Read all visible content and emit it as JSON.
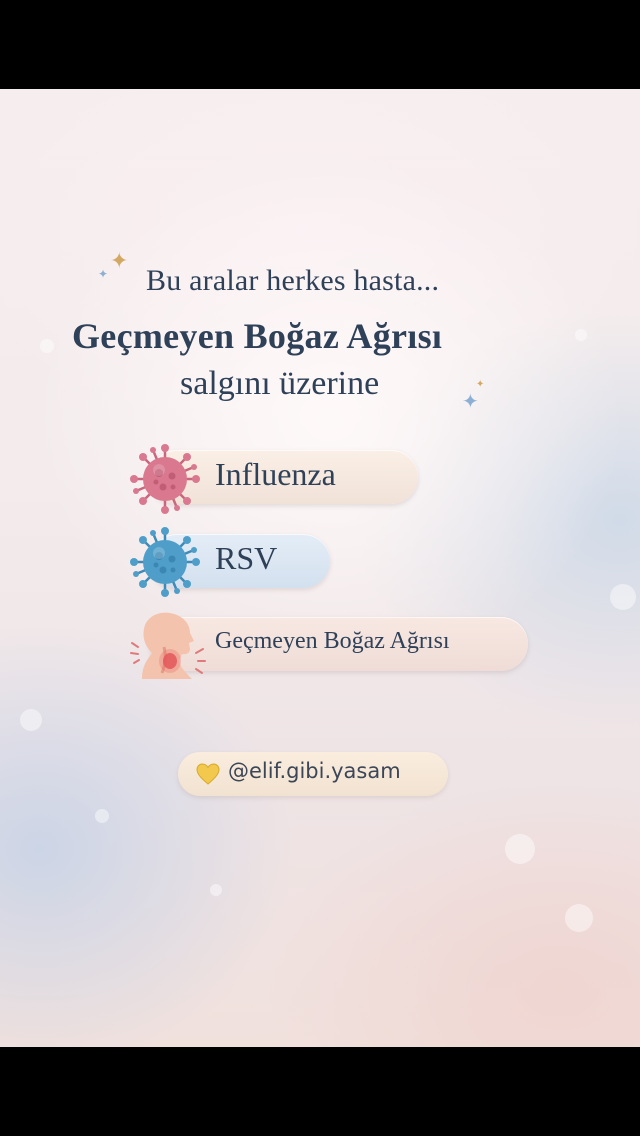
{
  "intro_line": "Bu aralar herkes hasta...",
  "title_line": "Geçmeyen Boğaz Ağrısı",
  "subtitle_line": "salgını üzerine",
  "items": [
    {
      "label": "Influenza",
      "icon": "pink-virus-icon"
    },
    {
      "label": "RSV",
      "icon": "blue-virus-icon"
    },
    {
      "label": "Geçmeyen Boğaz Ağrısı",
      "icon": "sore-throat-icon"
    }
  ],
  "handle": {
    "icon": "yellow-heart-icon",
    "text": "@elif.gibi.yasam"
  },
  "colors": {
    "text": "#2f4158",
    "pink_virus": "#d9788f",
    "blue_virus": "#4e9ec9",
    "sparkle_gold": "#d2a864",
    "sparkle_blue": "#8cb0d4",
    "heart": "#f2c94c"
  }
}
